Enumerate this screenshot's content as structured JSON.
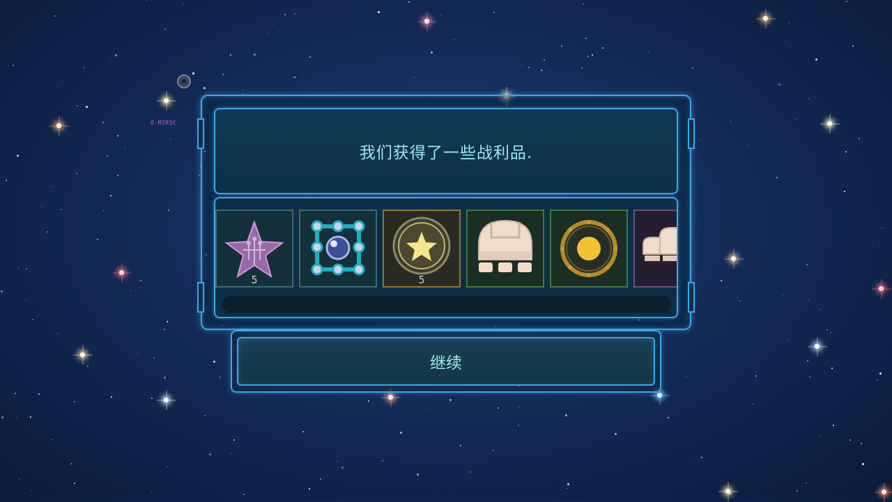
{
  "map": {
    "system_label": "O-M2R5C"
  },
  "dialog": {
    "message": "我们获得了一些战利品.",
    "continue_label": "继续",
    "loot_items": [
      {
        "icon": "circuit-star-icon",
        "count": "5",
        "rarity_color": "#3c6a74"
      },
      {
        "icon": "node-grid-module-icon",
        "count": "",
        "rarity_color": "#3c6a74"
      },
      {
        "icon": "gold-star-medal-icon",
        "count": "5",
        "rarity_color": "#8a7a3a"
      },
      {
        "icon": "dome-base-icon",
        "count": "",
        "rarity_color": "#3f7a44"
      },
      {
        "icon": "gold-ring-orb-icon",
        "count": "",
        "rarity_color": "#3f7a44"
      },
      {
        "icon": "armor-pod-icon",
        "count": "",
        "rarity_color": "#6a4f7a"
      }
    ]
  },
  "colors": {
    "frame_blue": "#3aa8e8",
    "text_cyan": "#9ee8ec",
    "space_bg": "#142b58"
  }
}
